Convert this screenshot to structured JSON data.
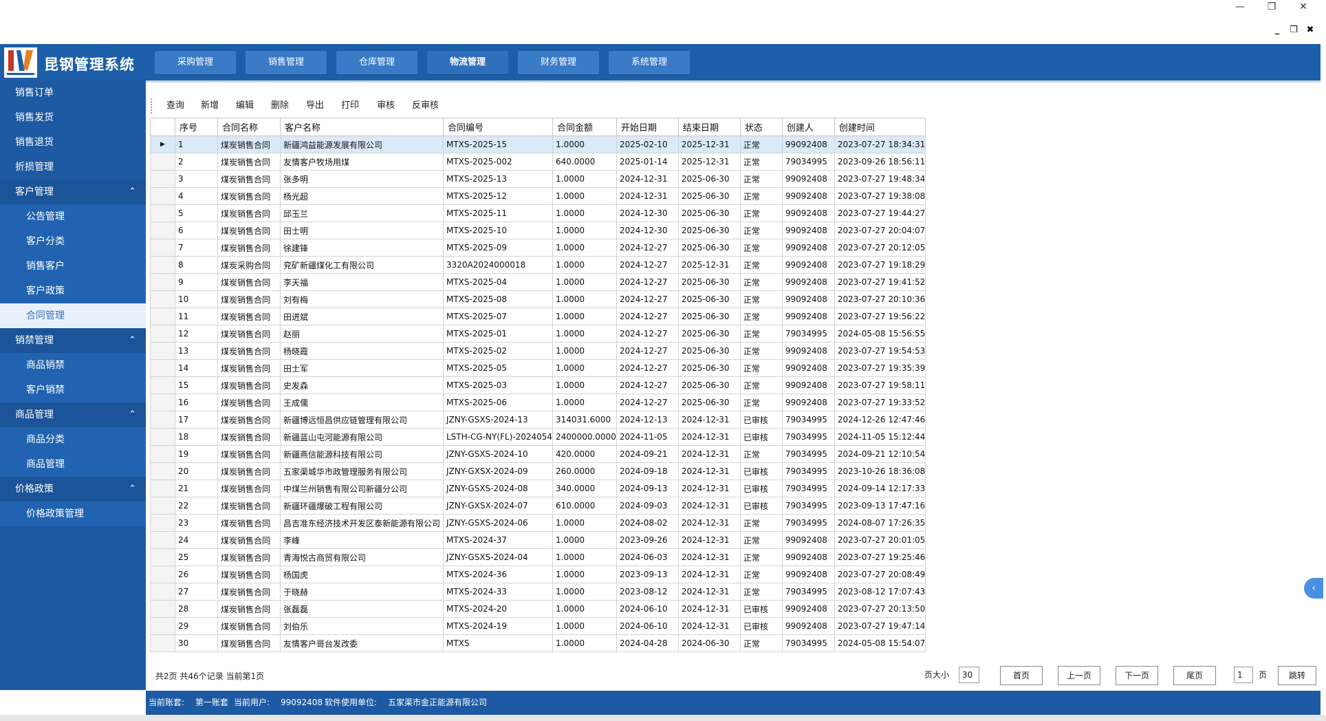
{
  "window": {
    "minimize_icon": "minimize-icon",
    "restore_icon": "restore-icon",
    "close_icon": "close-icon"
  },
  "app": {
    "title": "昆钢管理系统"
  },
  "top_tabs": [
    {
      "label": "采购管理"
    },
    {
      "label": "销售管理"
    },
    {
      "label": "仓库管理"
    },
    {
      "label": "物流管理"
    },
    {
      "label": "财务管理"
    },
    {
      "label": "系统管理"
    }
  ],
  "sidebar": {
    "items": [
      {
        "label": "销售订单",
        "type": "item"
      },
      {
        "label": "销售发货",
        "type": "item"
      },
      {
        "label": "销售退货",
        "type": "item"
      },
      {
        "label": "折损管理",
        "type": "item"
      },
      {
        "label": "客户管理",
        "type": "group"
      },
      {
        "label": "公告管理",
        "type": "sub"
      },
      {
        "label": "客户分类",
        "type": "sub"
      },
      {
        "label": "销售客户",
        "type": "sub"
      },
      {
        "label": "客户政策",
        "type": "sub"
      },
      {
        "label": "合同管理",
        "type": "sub",
        "active": true
      },
      {
        "label": "销禁管理",
        "type": "group"
      },
      {
        "label": "商品销禁",
        "type": "sub"
      },
      {
        "label": "客户销禁",
        "type": "sub"
      },
      {
        "label": "商品管理",
        "type": "group"
      },
      {
        "label": "商品分类",
        "type": "sub"
      },
      {
        "label": "商品管理",
        "type": "sub"
      },
      {
        "label": "价格政策",
        "type": "group"
      },
      {
        "label": "价格政策管理",
        "type": "sub"
      }
    ]
  },
  "toolbar": {
    "buttons": [
      "查询",
      "新增",
      "编辑",
      "删除",
      "导出",
      "打印",
      "审核",
      "反审核"
    ]
  },
  "grid": {
    "columns": [
      "序号",
      "合同名称",
      "客户名称",
      "合同编号",
      "合同金额",
      "开始日期",
      "结束日期",
      "状态",
      "创建人",
      "创建时间"
    ],
    "rows": [
      [
        "1",
        "煤炭销售合同",
        "新疆鸿益能源发展有限公司",
        "MTXS-2025-15",
        "1.0000",
        "2025-02-10",
        "2025-12-31",
        "正常",
        "99092408",
        "2023-07-27 18:34:31"
      ],
      [
        "2",
        "煤炭销售合同",
        "友情客户牧场用煤",
        "MTXS-2025-002",
        "640.0000",
        "2025-01-14",
        "2025-12-31",
        "正常",
        "79034995",
        "2023-09-26 18:56:11"
      ],
      [
        "3",
        "煤炭销售合同",
        "张多明",
        "MTXS-2025-13",
        "1.0000",
        "2024-12-31",
        "2025-06-30",
        "正常",
        "99092408",
        "2023-07-27 19:48:34"
      ],
      [
        "4",
        "煤炭销售合同",
        "杨光超",
        "MTXS-2025-12",
        "1.0000",
        "2024-12-31",
        "2025-06-30",
        "正常",
        "99092408",
        "2023-07-27 19:38:08"
      ],
      [
        "5",
        "煤炭销售合同",
        "邱玉兰",
        "MTXS-2025-11",
        "1.0000",
        "2024-12-30",
        "2025-06-30",
        "正常",
        "99092408",
        "2023-07-27 19:44:27"
      ],
      [
        "6",
        "煤炭销售合同",
        "田士明",
        "MTXS-2025-10",
        "1.0000",
        "2024-12-30",
        "2025-06-30",
        "正常",
        "99092408",
        "2023-07-27 20:04:07"
      ],
      [
        "7",
        "煤炭销售合同",
        "徐建锋",
        "MTXS-2025-09",
        "1.0000",
        "2024-12-27",
        "2025-06-30",
        "正常",
        "99092408",
        "2023-07-27 20:12:05"
      ],
      [
        "8",
        "煤炭采购合同",
        "兖矿新疆煤化工有限公司",
        "3320A2024000018",
        "1.0000",
        "2024-12-27",
        "2025-12-31",
        "正常",
        "99092408",
        "2023-07-27 19:18:29"
      ],
      [
        "9",
        "煤炭销售合同",
        "李天福",
        "MTXS-2025-04",
        "1.0000",
        "2024-12-27",
        "2025-06-30",
        "正常",
        "99092408",
        "2023-07-27 19:41:52"
      ],
      [
        "10",
        "煤炭销售合同",
        "刘有梅",
        "MTXS-2025-08",
        "1.0000",
        "2024-12-27",
        "2025-06-30",
        "正常",
        "99092408",
        "2023-07-27 20:10:36"
      ],
      [
        "11",
        "煤炭销售合同",
        "田进斌",
        "MTXS-2025-07",
        "1.0000",
        "2024-12-27",
        "2025-06-30",
        "正常",
        "99092408",
        "2023-07-27 19:56:22"
      ],
      [
        "12",
        "煤炭销售合同",
        "赵丽",
        "MTXS-2025-01",
        "1.0000",
        "2024-12-27",
        "2025-06-30",
        "正常",
        "79034995",
        "2024-05-08 15:56:55"
      ],
      [
        "13",
        "煤炭销售合同",
        "杨晓霞",
        "MTXS-2025-02",
        "1.0000",
        "2024-12-27",
        "2025-06-30",
        "正常",
        "99092408",
        "2023-07-27 19:54:53"
      ],
      [
        "14",
        "煤炭销售合同",
        "田士军",
        "MTXS-2025-05",
        "1.0000",
        "2024-12-27",
        "2025-06-30",
        "正常",
        "99092408",
        "2023-07-27 19:35:39"
      ],
      [
        "15",
        "煤炭销售合同",
        "史发森",
        "MTXS-2025-03",
        "1.0000",
        "2024-12-27",
        "2025-06-30",
        "正常",
        "99092408",
        "2023-07-27 19:58:11"
      ],
      [
        "16",
        "煤炭销售合同",
        "王成儒",
        "MTXS-2025-06",
        "1.0000",
        "2024-12-27",
        "2025-06-30",
        "正常",
        "99092408",
        "2023-07-27 19:33:52"
      ],
      [
        "17",
        "煤炭销售合同",
        "新疆博远恒昌供应链管理有限公司",
        "JZNY-GSXS-2024-13",
        "314031.6000",
        "2024-12-13",
        "2024-12-31",
        "已审核",
        "79034995",
        "2024-12-26 12:47:46"
      ],
      [
        "18",
        "煤炭销售合同",
        "新疆蓝山屯河能源有限公司",
        "LSTH-CG-NY(FL)-2024054",
        "2400000.0000",
        "2024-11-05",
        "2024-12-31",
        "已审核",
        "79034995",
        "2024-11-05 15:12:44"
      ],
      [
        "19",
        "煤炭销售合同",
        "新疆燕信能源科技有限公司",
        "JZNY-GSXS-2024-10",
        "420.0000",
        "2024-09-21",
        "2024-12-31",
        "正常",
        "79034995",
        "2024-09-21 12:10:54"
      ],
      [
        "20",
        "煤炭销售合同",
        "五家渠城华市政管理服务有限公司",
        "JZNY-GXSX-2024-09",
        "260.0000",
        "2024-09-18",
        "2024-12-31",
        "已审核",
        "79034995",
        "2023-10-26 18:36:08"
      ],
      [
        "21",
        "煤炭销售合同",
        "中煤兰州销售有限公司新疆分公司",
        "JZNY-GSXS-2024-08",
        "340.0000",
        "2024-09-13",
        "2024-12-31",
        "已审核",
        "79034995",
        "2024-09-14 12:17:33"
      ],
      [
        "22",
        "煤炭销售合同",
        "新疆环疆爆破工程有限公司",
        "JZNY-GXSX-2024-07",
        "610.0000",
        "2024-09-03",
        "2024-12-31",
        "已审核",
        "79034995",
        "2023-09-13 17:47:16"
      ],
      [
        "23",
        "煤炭销售合同",
        "昌吉准东经济技术开发区泰新能源有限公司",
        "JZNY-GSXS-2024-06",
        "1.0000",
        "2024-08-02",
        "2024-12-31",
        "正常",
        "79034995",
        "2024-08-07 17:26:35"
      ],
      [
        "24",
        "煤炭销售合同",
        "李峰",
        "MTXS-2024-37",
        "1.0000",
        "2023-09-26",
        "2024-12-31",
        "正常",
        "99092408",
        "2023-07-27 20:01:05"
      ],
      [
        "25",
        "煤炭销售合同",
        "青海悦古商贸有限公司",
        "JZNY-GSXS-2024-04",
        "1.0000",
        "2024-06-03",
        "2024-12-31",
        "正常",
        "99092408",
        "2023-07-27 19:25:46"
      ],
      [
        "26",
        "煤炭销售合同",
        "杨国虎",
        "MTXS-2024-36",
        "1.0000",
        "2023-09-13",
        "2024-12-31",
        "正常",
        "99092408",
        "2023-07-27 20:08:49"
      ],
      [
        "27",
        "煤炭销售合同",
        "于晓赫",
        "MTXS-2024-33",
        "1.0000",
        "2023-08-12",
        "2024-12-31",
        "正常",
        "79034995",
        "2023-08-12 17:07:43"
      ],
      [
        "28",
        "煤炭销售合同",
        "张磊磊",
        "MTXS-2024-20",
        "1.0000",
        "2024-06-10",
        "2024-12-31",
        "已审核",
        "99092408",
        "2023-07-27 20:13:50"
      ],
      [
        "29",
        "煤炭销售合同",
        "刘伯乐",
        "MTXS-2024-19",
        "1.0000",
        "2024-06-10",
        "2024-12-31",
        "已审核",
        "99092408",
        "2023-07-27 19:47:14"
      ],
      [
        "30",
        "煤炭销售合同",
        "友情客户哥台发改委",
        "MTXS",
        "1.0000",
        "2024-04-28",
        "2024-06-30",
        "正常",
        "79034995",
        "2024-05-08 15:54:07"
      ]
    ],
    "selected_index": 0
  },
  "pager": {
    "summary": "共2页  共46个记录  当前第1页",
    "page_size_label": "页大小",
    "page_size_value": "30",
    "first": "首页",
    "prev": "上一页",
    "next": "下一页",
    "last": "尾页",
    "page_input": "1",
    "page_unit": "页",
    "jump": "跳转"
  },
  "status": {
    "account_label": "当前账套:",
    "account_value": "第一账套",
    "user_label": "当前用户:",
    "user_value": "99092408",
    "unit_label": "软件使用单位:",
    "unit_value": "五家渠市金正能源有限公司"
  }
}
